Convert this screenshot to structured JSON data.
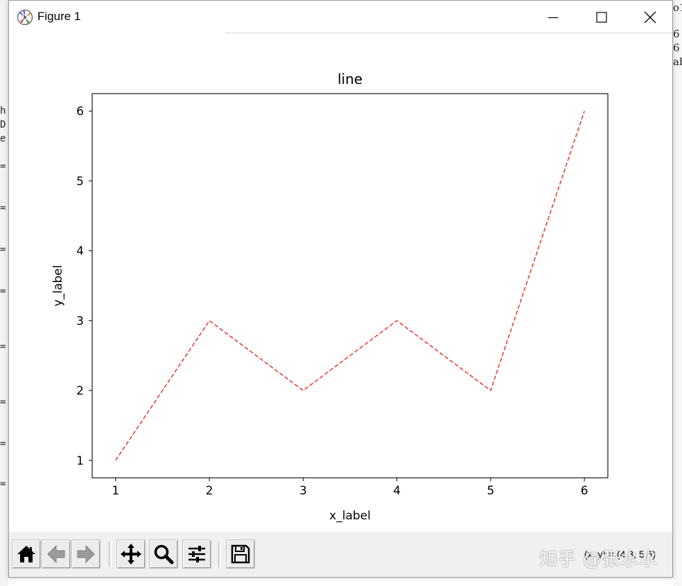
{
  "window": {
    "title": "Figure 1"
  },
  "chart_data": {
    "type": "line",
    "title": "line",
    "xlabel": "x_label",
    "ylabel": "y_label",
    "x": [
      1,
      2,
      3,
      4,
      5,
      6
    ],
    "series": [
      {
        "values": [
          1,
          3,
          2,
          3,
          2,
          6
        ],
        "color": "#e8413a",
        "linestyle": "dashed"
      }
    ],
    "xlim": [
      0.75,
      6.25
    ],
    "ylim": [
      0.75,
      6.25
    ],
    "xticks": [
      1,
      2,
      3,
      4,
      5,
      6
    ],
    "yticks": [
      1,
      2,
      3,
      4,
      5,
      6
    ],
    "grid": false
  },
  "toolbar": {
    "buttons": [
      {
        "name": "home-button",
        "icon": "home-icon"
      },
      {
        "name": "back-button",
        "icon": "arrow-left-icon"
      },
      {
        "name": "forward-button",
        "icon": "arrow-right-icon"
      },
      {
        "name": "pan-button",
        "icon": "move-icon"
      },
      {
        "name": "zoom-button",
        "icon": "magnifier-icon"
      },
      {
        "name": "configure-subplots-button",
        "icon": "sliders-icon"
      },
      {
        "name": "save-button",
        "icon": "floppy-disk-icon"
      }
    ],
    "coordinates": "(x, y) = (4.3, 5.6)"
  },
  "watermark": "知乎 @张水水",
  "background_fragments": {
    "left": [
      "h",
      "D",
      "e",
      "=",
      "=",
      "=",
      "=",
      "=",
      "=",
      "=",
      "="
    ],
    "right": [
      "o1",
      "6",
      "6",
      "ab"
    ]
  }
}
